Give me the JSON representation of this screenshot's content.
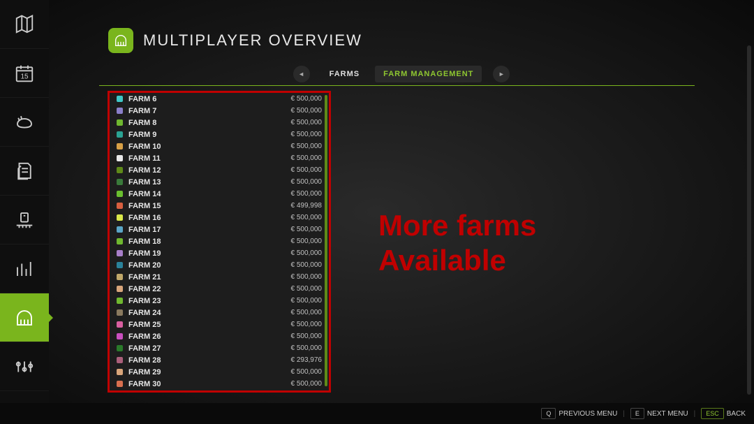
{
  "header": {
    "title": "MULTIPLAYER OVERVIEW"
  },
  "tabs": {
    "prev_glyph": "◄",
    "next_glyph": "►",
    "items": [
      {
        "label": "FARMS",
        "active": false
      },
      {
        "label": "FARM MANAGEMENT",
        "active": true
      }
    ]
  },
  "farms": [
    {
      "name": "FARM 6",
      "value": "€ 500,000",
      "color": "#3fc7c7"
    },
    {
      "name": "FARM 7",
      "value": "€ 500,000",
      "color": "#8a7fc9"
    },
    {
      "name": "FARM 8",
      "value": "€ 500,000",
      "color": "#6fb82f"
    },
    {
      "name": "FARM 9",
      "value": "€ 500,000",
      "color": "#2aa393"
    },
    {
      "name": "FARM 10",
      "value": "€ 500,000",
      "color": "#d8a046"
    },
    {
      "name": "FARM 11",
      "value": "€ 500,000",
      "color": "#e8e8e8"
    },
    {
      "name": "FARM 12",
      "value": "€ 500,000",
      "color": "#5f8a18"
    },
    {
      "name": "FARM 13",
      "value": "€ 500,000",
      "color": "#3a7a3a"
    },
    {
      "name": "FARM 14",
      "value": "€ 500,000",
      "color": "#6abf2f"
    },
    {
      "name": "FARM 15",
      "value": "€ 499,998",
      "color": "#d85f3f"
    },
    {
      "name": "FARM 16",
      "value": "€ 500,000",
      "color": "#d9e84a"
    },
    {
      "name": "FARM 17",
      "value": "€ 500,000",
      "color": "#5aa6c7"
    },
    {
      "name": "FARM 18",
      "value": "€ 500,000",
      "color": "#6fb82f"
    },
    {
      "name": "FARM 19",
      "value": "€ 500,000",
      "color": "#a87fc9"
    },
    {
      "name": "FARM 20",
      "value": "€ 500,000",
      "color": "#2a829a"
    },
    {
      "name": "FARM 21",
      "value": "€ 500,000",
      "color": "#c0a86a"
    },
    {
      "name": "FARM 22",
      "value": "€ 500,000",
      "color": "#d8a57a"
    },
    {
      "name": "FARM 23",
      "value": "€ 500,000",
      "color": "#6fb82f"
    },
    {
      "name": "FARM 24",
      "value": "€ 500,000",
      "color": "#8a7a5f"
    },
    {
      "name": "FARM 25",
      "value": "€ 500,000",
      "color": "#d85fa0"
    },
    {
      "name": "FARM 26",
      "value": "€ 500,000",
      "color": "#c94fbf"
    },
    {
      "name": "FARM 27",
      "value": "€ 500,000",
      "color": "#2a7a2a"
    },
    {
      "name": "FARM 28",
      "value": "€ 293,976",
      "color": "#aa5f7a"
    },
    {
      "name": "FARM 29",
      "value": "€ 500,000",
      "color": "#d8a57a"
    },
    {
      "name": "FARM 30",
      "value": "€ 500,000",
      "color": "#d86f4f"
    }
  ],
  "annotation": {
    "line1": "More farms",
    "line2": "Available"
  },
  "footer": {
    "q_key": "Q",
    "q_label": "PREVIOUS MENU",
    "e_key": "E",
    "e_label": "NEXT MENU",
    "esc_key": "ESC",
    "esc_label": "BACK"
  },
  "sidebar_icons": [
    "map-icon",
    "calendar-icon",
    "animals-icon",
    "contracts-icon",
    "production-icon",
    "stats-icon",
    "multiplayer-icon",
    "settings-icon"
  ]
}
